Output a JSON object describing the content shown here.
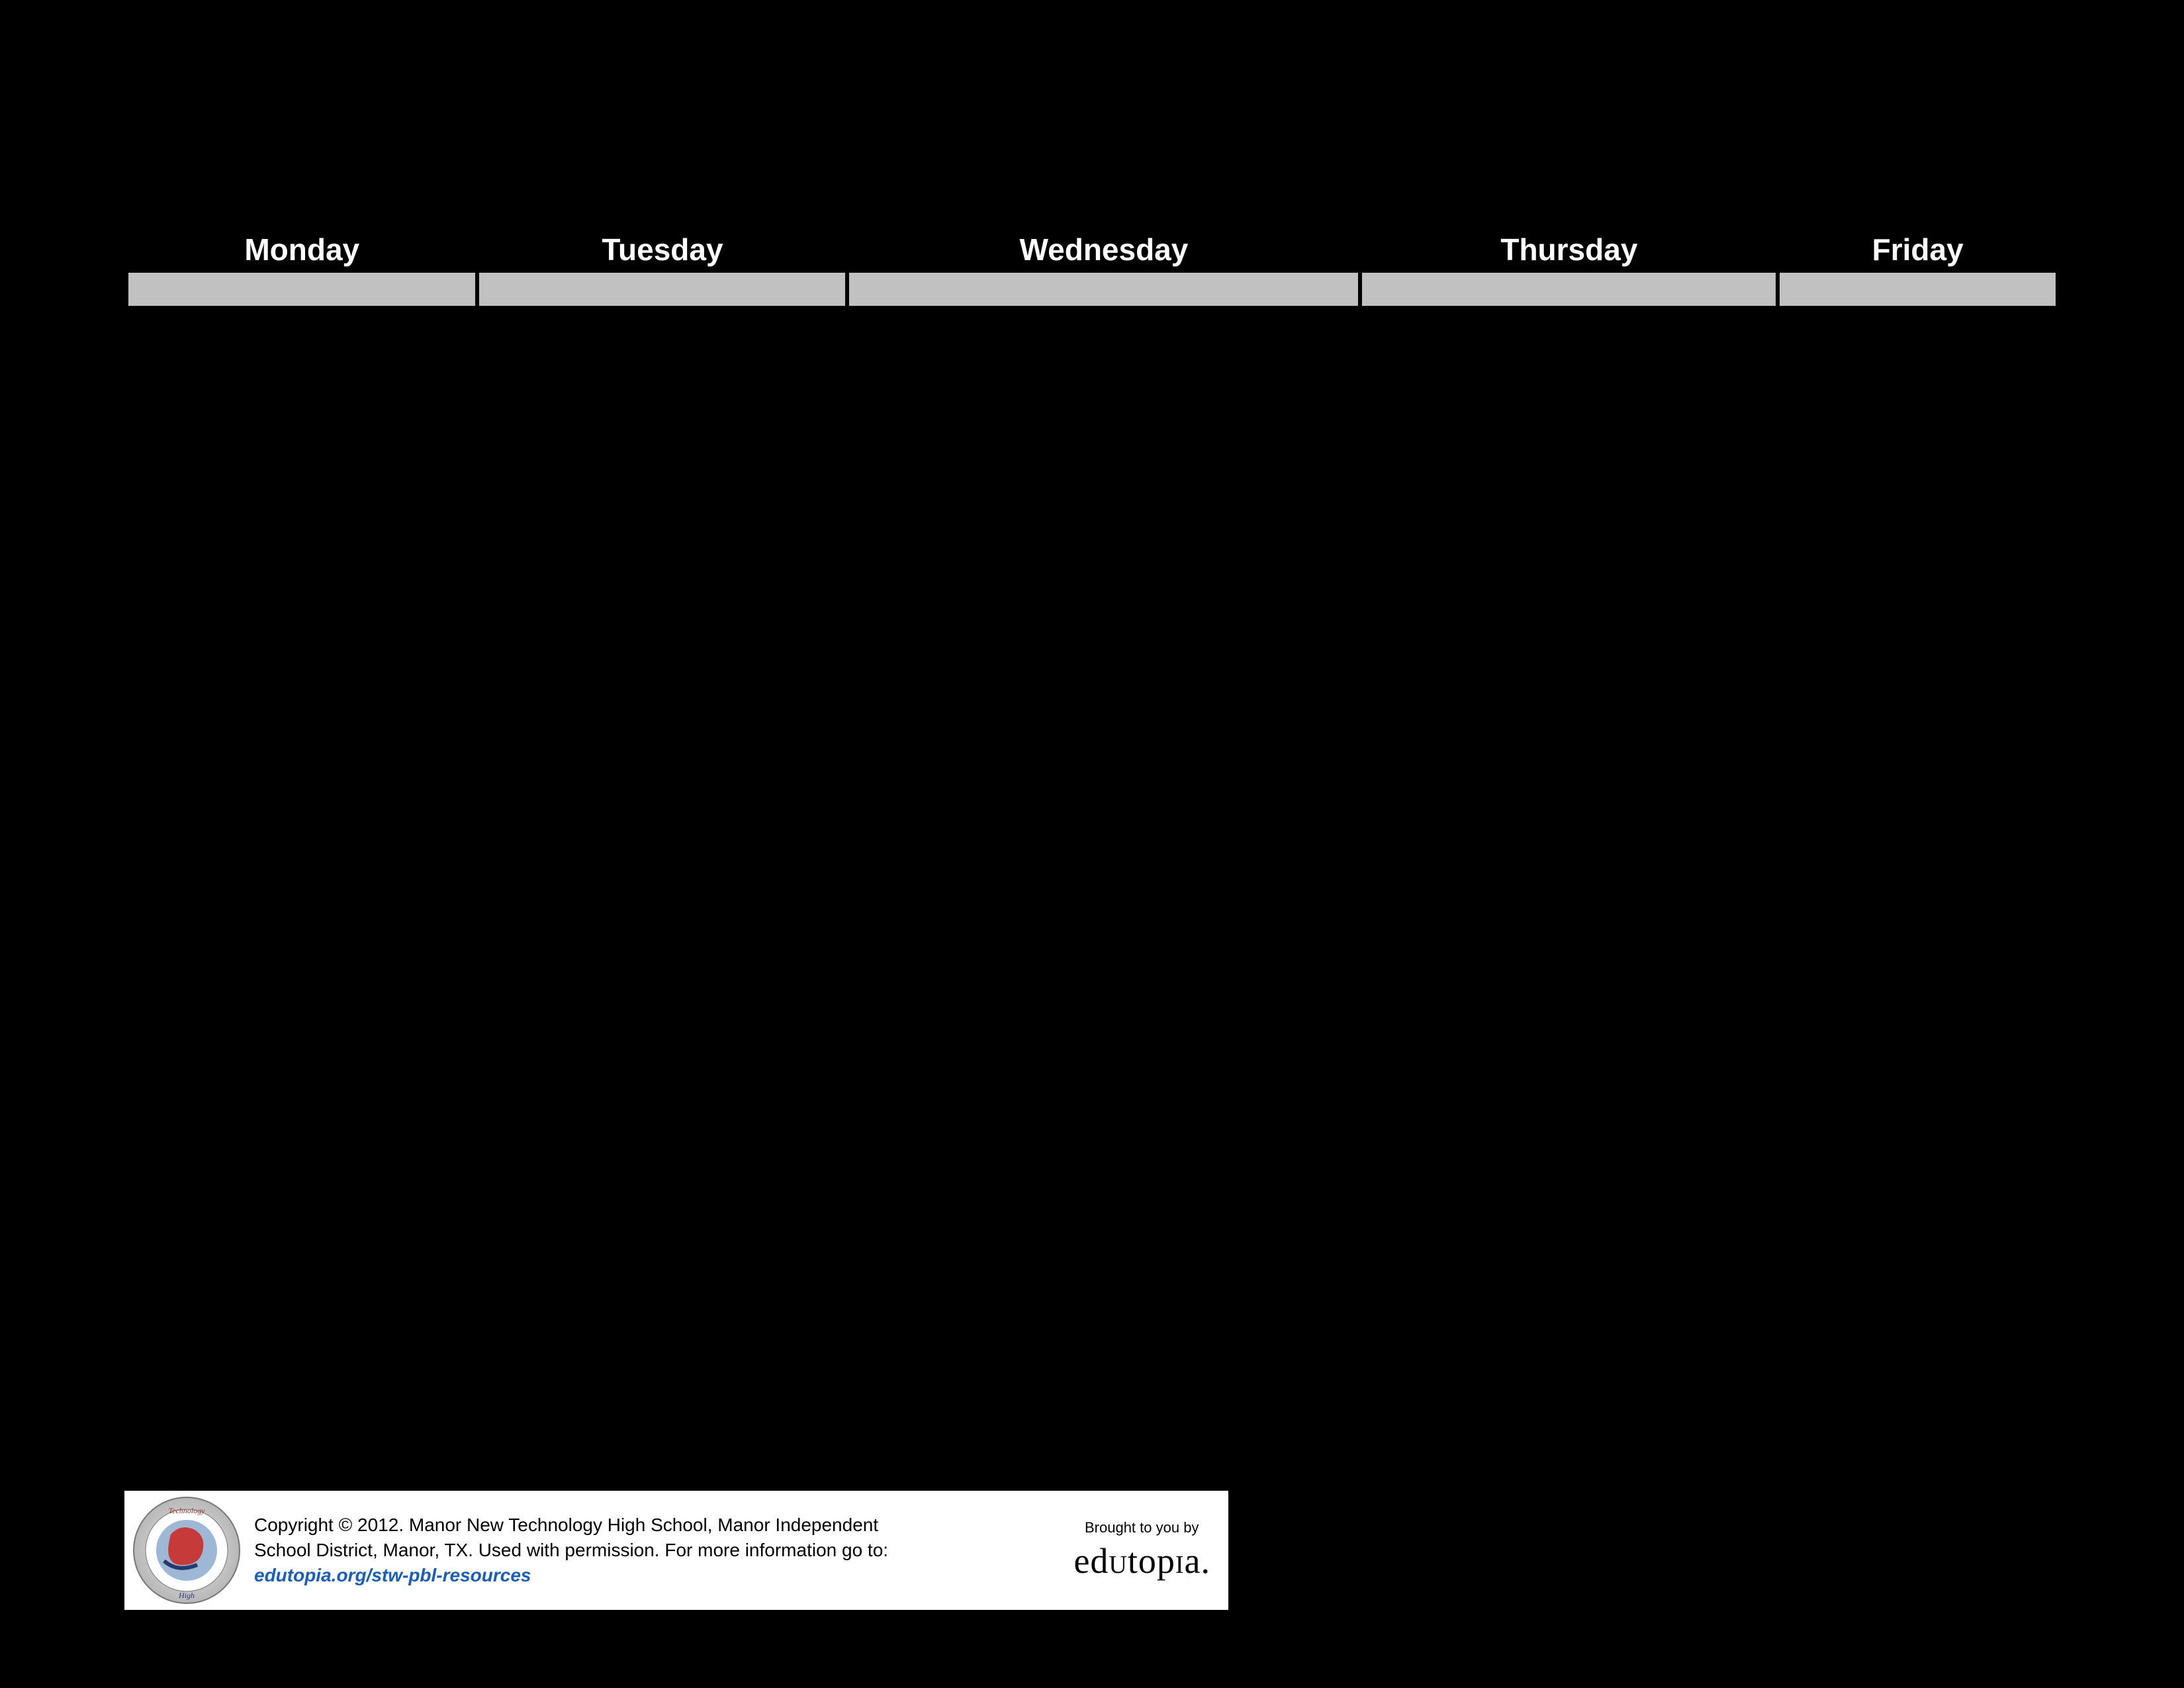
{
  "week": {
    "days": [
      "Monday",
      "Tuesday",
      "Wednesday",
      "Thursday",
      "Friday"
    ]
  },
  "footer": {
    "copyright_line1": "Copyright © 2012. Manor New Technology High School, Manor Independent",
    "copyright_line2": "School District, Manor, TX. Used with permission. For more information go to:",
    "link_text": "edutopia.org/stw-pbl-resources",
    "brought_label": "Brought to you by",
    "brand": "edutopia"
  }
}
